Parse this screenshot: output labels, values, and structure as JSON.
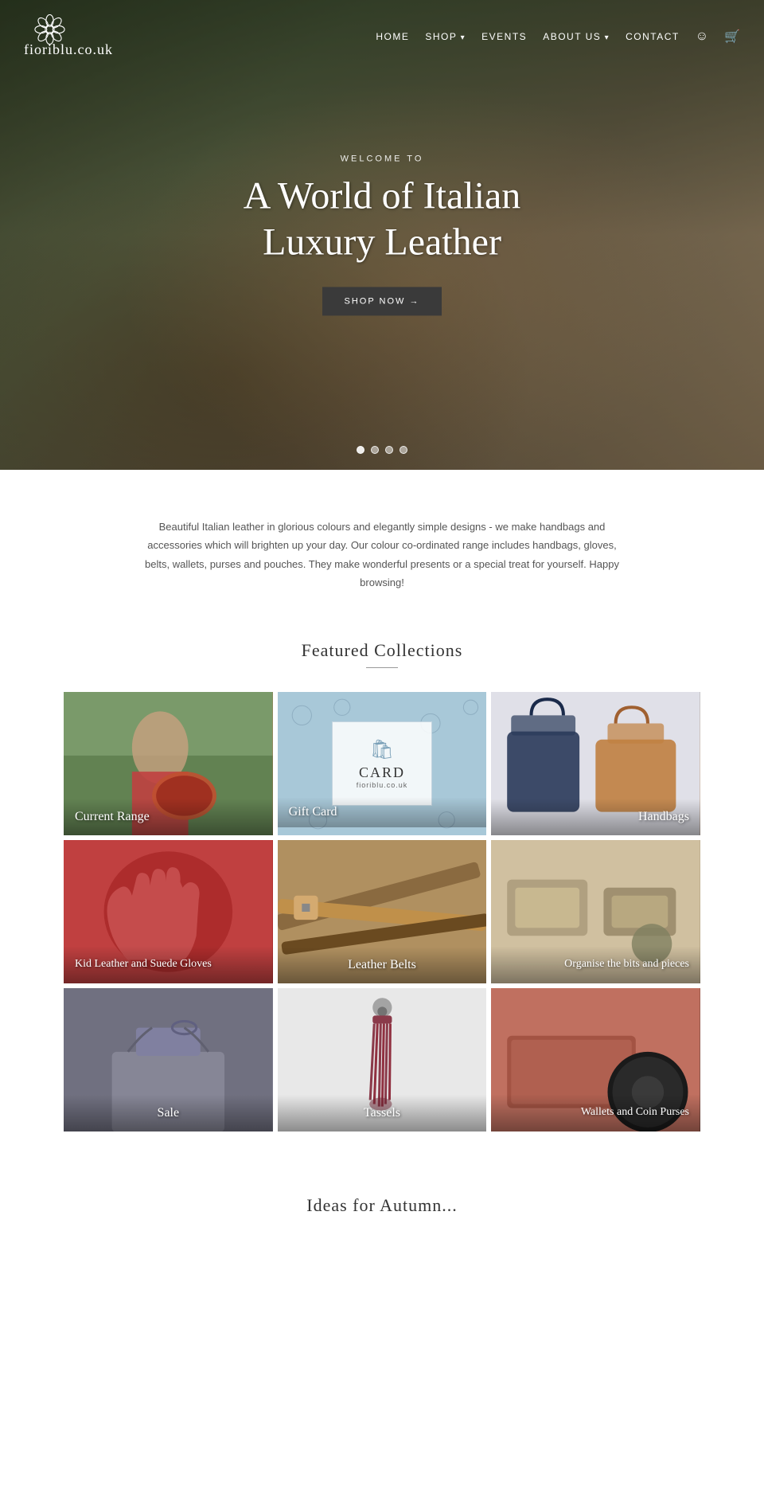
{
  "nav": {
    "logo_text": "fioriblu.co.uk",
    "links": [
      {
        "label": "HOME",
        "id": "home",
        "dropdown": false
      },
      {
        "label": "SHOP",
        "id": "shop",
        "dropdown": true
      },
      {
        "label": "EVENTS",
        "id": "events",
        "dropdown": false
      },
      {
        "label": "ABOUT US",
        "id": "about",
        "dropdown": true
      },
      {
        "label": "CONTACT",
        "id": "contact",
        "dropdown": false
      }
    ]
  },
  "hero": {
    "welcome": "WELCOME TO",
    "title": "A World of Italian Luxury Leather",
    "cta_label": "SHOP NOW →",
    "dots_count": 4,
    "active_dot": 0
  },
  "intro": {
    "text": "Beautiful Italian leather in glorious colours and elegantly simple designs - we make handbags and accessories which will brighten up your day. Our colour co-ordinated range includes handbags, gloves, belts, wallets, purses and pouches. They make wonderful presents or a special treat for yourself. Happy browsing!"
  },
  "featured": {
    "title": "Featured Collections",
    "collections": [
      {
        "id": "current-range",
        "label": "Current Range",
        "bg_class": "bg-current-range",
        "label_position": "bottom-left"
      },
      {
        "id": "gift-card",
        "label": "Gift Card",
        "bg_class": "bg-gift-card",
        "is_gift": true
      },
      {
        "id": "handbags",
        "label": "Handbags",
        "bg_class": "bg-handbags",
        "label_position": "bottom-right"
      },
      {
        "id": "gloves",
        "label": "Kid Leather and Suede Gloves",
        "bg_class": "bg-gloves",
        "label_position": "bottom-left",
        "multiline": true
      },
      {
        "id": "belts",
        "label": "Leather Belts",
        "bg_class": "bg-belts",
        "label_position": "bottom-center"
      },
      {
        "id": "organise",
        "label": "Organise the bits and pieces",
        "bg_class": "bg-organise",
        "label_position": "bottom-right",
        "multiline": true
      },
      {
        "id": "sale",
        "label": "Sale",
        "bg_class": "bg-sale",
        "label_position": "bottom-center"
      },
      {
        "id": "tassels",
        "label": "Tassels",
        "bg_class": "bg-tassels",
        "label_position": "bottom-center"
      },
      {
        "id": "wallets",
        "label": "Wallets and Coin Purses",
        "bg_class": "bg-wallets",
        "label_position": "bottom-right",
        "multiline": true
      }
    ],
    "gift_card": {
      "icon": "🛍",
      "text": "Gift Card",
      "card_text": "CARD",
      "subtext": "fioriblu.co.uk"
    }
  },
  "ideas": {
    "title": "Ideas for Autumn..."
  }
}
